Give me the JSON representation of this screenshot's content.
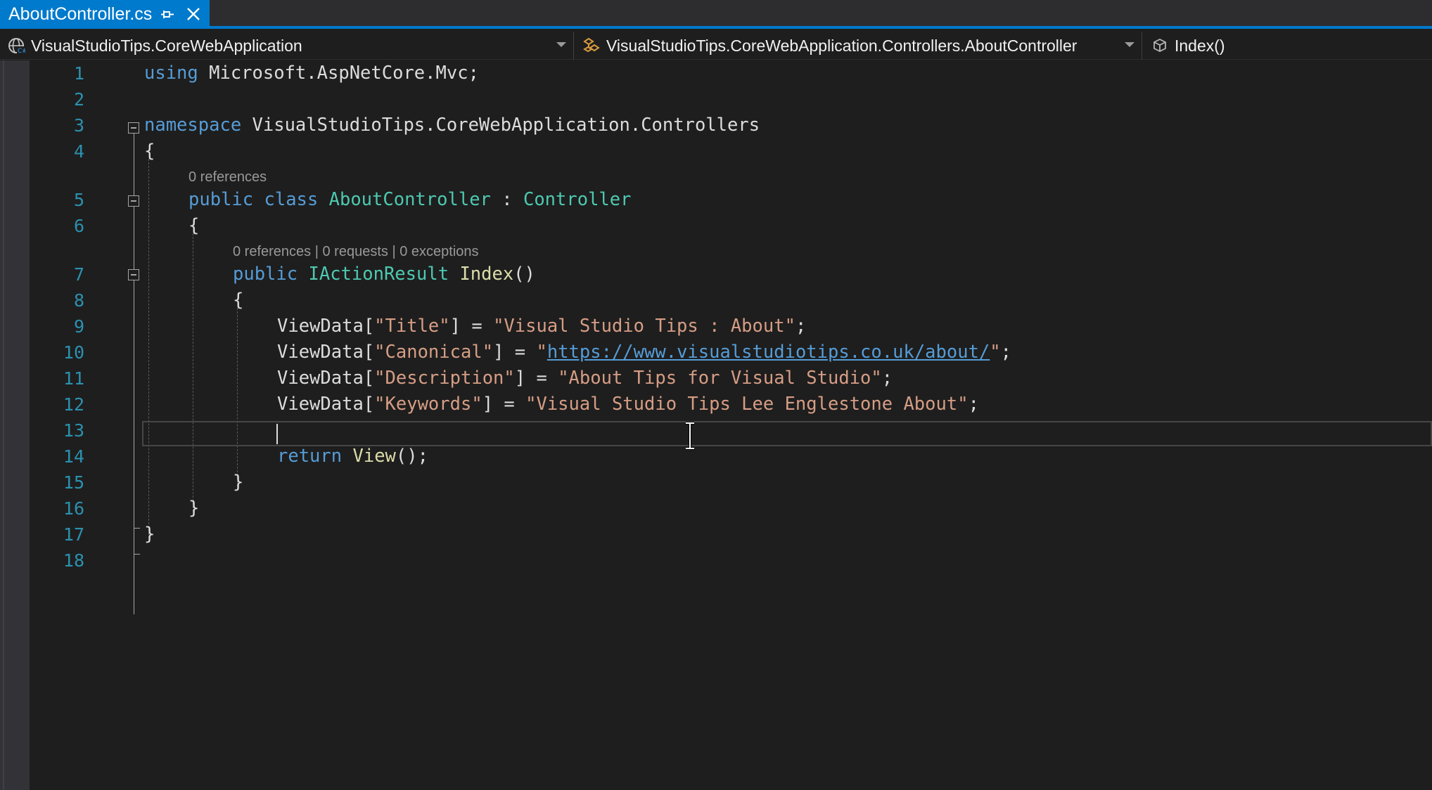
{
  "tab": {
    "title": "AboutController.cs",
    "pin_icon": "pin-icon",
    "close_icon": "close-icon"
  },
  "navbar": {
    "project": "VisualStudioTips.CoreWebApplication",
    "class": "VisualStudioTips.CoreWebApplication.Controllers.AboutController",
    "member": "Index()"
  },
  "editor": {
    "line_numbers": [
      "1",
      "2",
      "3",
      "4",
      "5",
      "6",
      "7",
      "8",
      "9",
      "10",
      "11",
      "12",
      "13",
      "14",
      "15",
      "16",
      "17",
      "18"
    ],
    "codelens": {
      "class_refs": "0 references",
      "method_refs": "0 references",
      "method_requests": "0 requests",
      "method_exceptions": "0 exceptions",
      "separator": "|"
    },
    "code": {
      "l1_kw": "using",
      "l1_rest": " Microsoft.AspNetCore.Mvc;",
      "l3_kw": "namespace",
      "l3_rest": " VisualStudioTips.CoreWebApplication.Controllers",
      "l4": "{",
      "l5_kw1": "public",
      "l5_kw2": "class",
      "l5_type": "AboutController",
      "l5_colon": " : ",
      "l5_base": "Controller",
      "l6": "{",
      "l7_kw": "public",
      "l7_type": "IActionResult",
      "l7_method": "Index",
      "l7_parens": "()",
      "l8": "{",
      "l9_a": "ViewData[",
      "l9_key": "\"Title\"",
      "l9_b": "] = ",
      "l9_val": "\"Visual Studio Tips : About\"",
      "l9_c": ";",
      "l10_a": "ViewData[",
      "l10_key": "\"Canonical\"",
      "l10_b": "] = ",
      "l10_q1": "\"",
      "l10_url": "https://www.visualstudiotips.co.uk/about/",
      "l10_q2": "\"",
      "l10_c": ";",
      "l11_a": "ViewData[",
      "l11_key": "\"Description\"",
      "l11_b": "] = ",
      "l11_val": "\"About Tips for Visual Studio\"",
      "l11_c": ";",
      "l12_a": "ViewData[",
      "l12_key": "\"Keywords\"",
      "l12_b": "] = ",
      "l12_val": "\"Visual Studio Tips Lee Englestone About\"",
      "l12_c": ";",
      "l14_kw": "return",
      "l14_method": "View",
      "l14_rest": "();",
      "l15": "}",
      "l16": "}",
      "l17": "}"
    }
  },
  "colors": {
    "accent": "#007acc",
    "keyword": "#569cd6",
    "type": "#4ec9b0",
    "string": "#d69d85",
    "method": "#dcdcaa",
    "line_number": "#2b91af"
  }
}
